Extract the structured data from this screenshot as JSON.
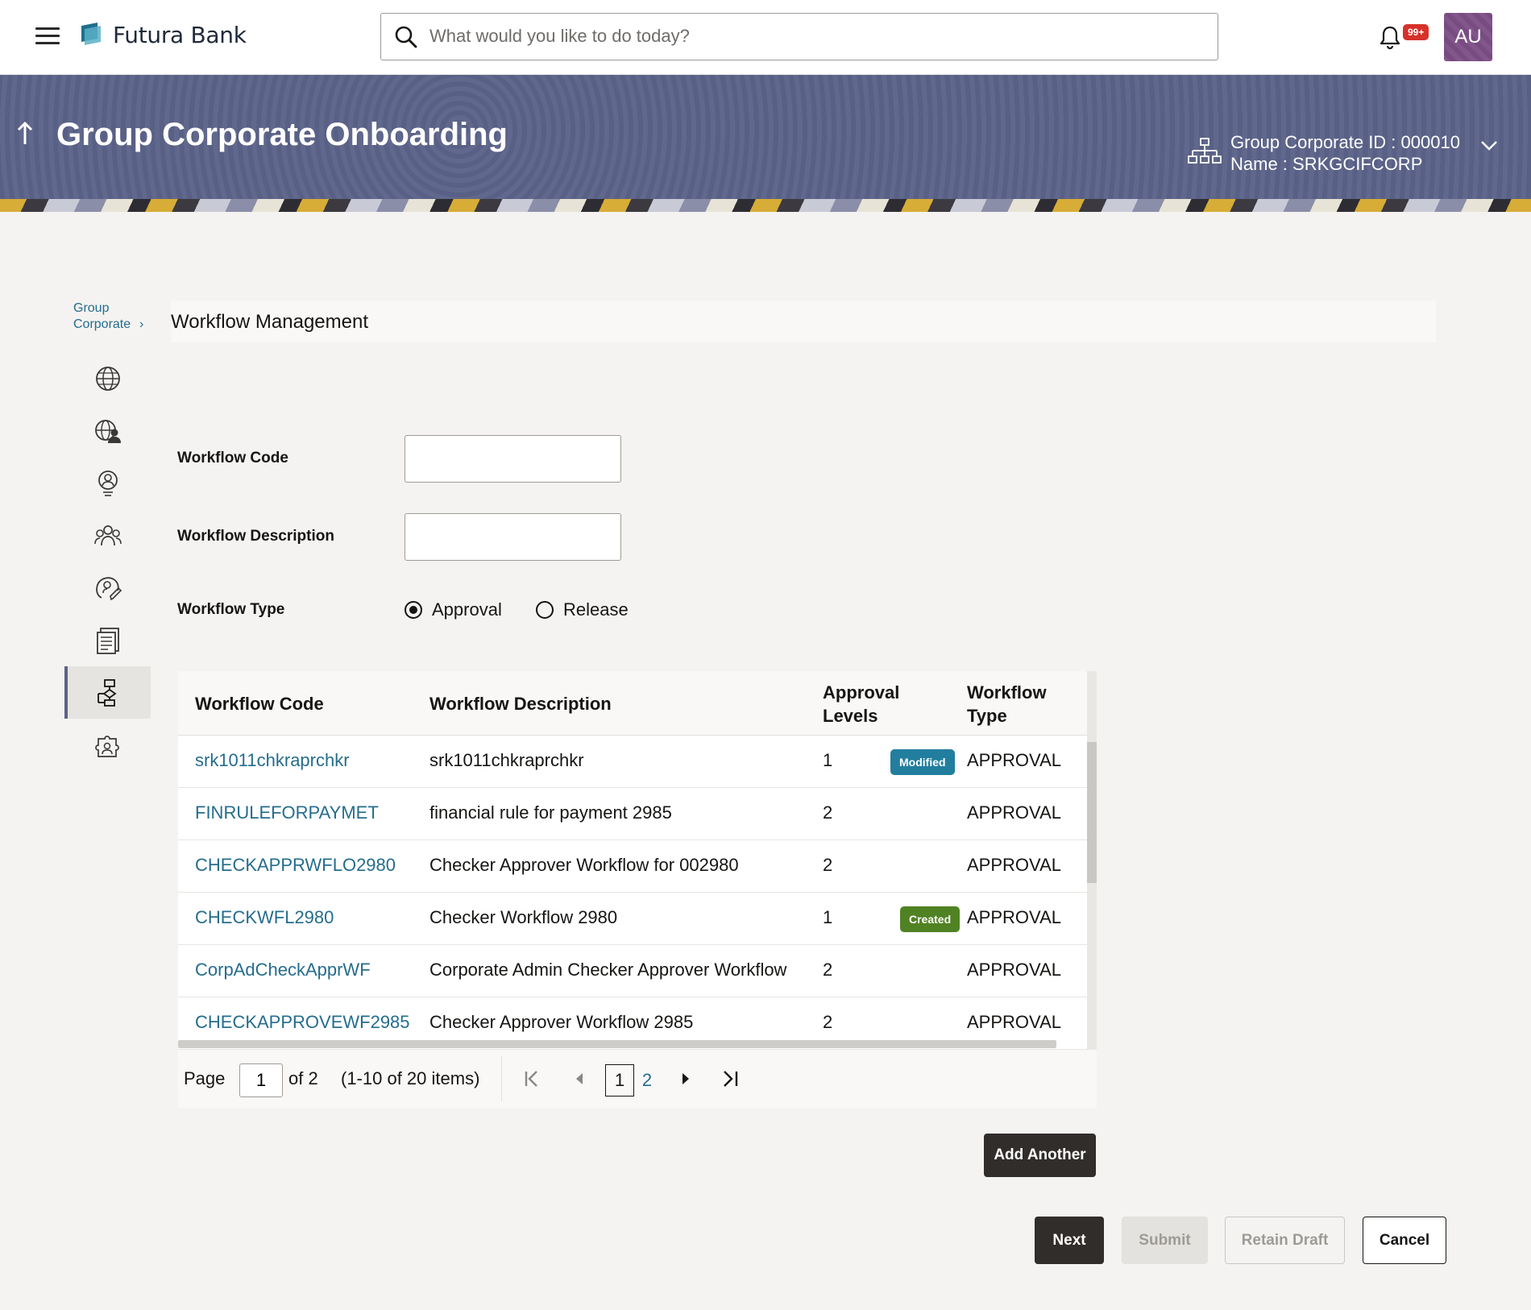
{
  "app": {
    "brand": "Futura Bank",
    "search_placeholder": "What would you like to do today?",
    "notification_badge": "99+",
    "avatar_initials": "AU",
    "colors": {
      "banner": "#5c6389",
      "link": "#256d8d",
      "primary_button": "#312d2a",
      "modified_tag": "#227e9e",
      "created_tag": "#508223",
      "badge": "#d6312a"
    }
  },
  "banner": {
    "title": "Group Corporate Onboarding",
    "corporate_id_line": "Group Corporate ID : 000010",
    "name_line": "Name : SRKGCIFCORP"
  },
  "sidebar": {
    "breadcrumb_line1": "Group",
    "breadcrumb_line2": "Corporate",
    "breadcrumb_chevron": "›",
    "items": [
      {
        "icon": "globe-icon"
      },
      {
        "icon": "globe-user-icon"
      },
      {
        "icon": "user-badge-icon"
      },
      {
        "icon": "users-group-icon"
      },
      {
        "icon": "user-edit-icon"
      },
      {
        "icon": "document-list-icon"
      },
      {
        "icon": "workflow-icon",
        "active": true
      },
      {
        "icon": "puzzle-users-icon"
      }
    ]
  },
  "section": {
    "title": "Workflow Management"
  },
  "form": {
    "workflow_code_label": "Workflow Code",
    "workflow_code_value": "",
    "workflow_description_label": "Workflow Description",
    "workflow_description_value": "",
    "workflow_type_label": "Workflow Type",
    "type_options": [
      {
        "label": "Approval",
        "selected": true
      },
      {
        "label": "Release",
        "selected": false
      }
    ]
  },
  "table": {
    "headers": {
      "code": "Workflow Code",
      "description": "Workflow Description",
      "levels_line1": "Approval",
      "levels_line2": "Levels",
      "type_line1": "Workflow",
      "type_line2": "Type"
    },
    "rows": [
      {
        "code": "srk1011chkraprchkr",
        "description": "srk1011chkraprchkr",
        "levels": "1",
        "tag": "Modified",
        "type": "APPROVAL"
      },
      {
        "code": "FINRULEFORPAYMET",
        "description": "financial rule for payment 2985",
        "levels": "2",
        "tag": "",
        "type": "APPROVAL"
      },
      {
        "code": "CHECKAPPRWFLO2980",
        "description": "Checker Approver Workflow for 002980",
        "levels": "2",
        "tag": "",
        "type": "APPROVAL"
      },
      {
        "code": "CHECKWFL2980",
        "description": "Checker Workflow 2980",
        "levels": "1",
        "tag": "Created",
        "type": "APPROVAL"
      },
      {
        "code": "CorpAdCheckApprWF",
        "description": "Corporate Admin Checker Approver Workflow",
        "levels": "2",
        "tag": "",
        "type": "APPROVAL"
      },
      {
        "code": "CHECKAPPROVEWF2985",
        "description": "Checker Approver Workflow 2985",
        "levels": "2",
        "tag": "",
        "type": "APPROVAL"
      }
    ]
  },
  "pagination": {
    "page_label": "Page",
    "current_page": "1",
    "of_label": "of 2",
    "items_label": "(1-10 of 20 items)",
    "pages": [
      "1",
      "2"
    ]
  },
  "buttons": {
    "add_another": "Add Another",
    "next": "Next",
    "submit": "Submit",
    "retain_draft": "Retain Draft",
    "cancel": "Cancel"
  }
}
